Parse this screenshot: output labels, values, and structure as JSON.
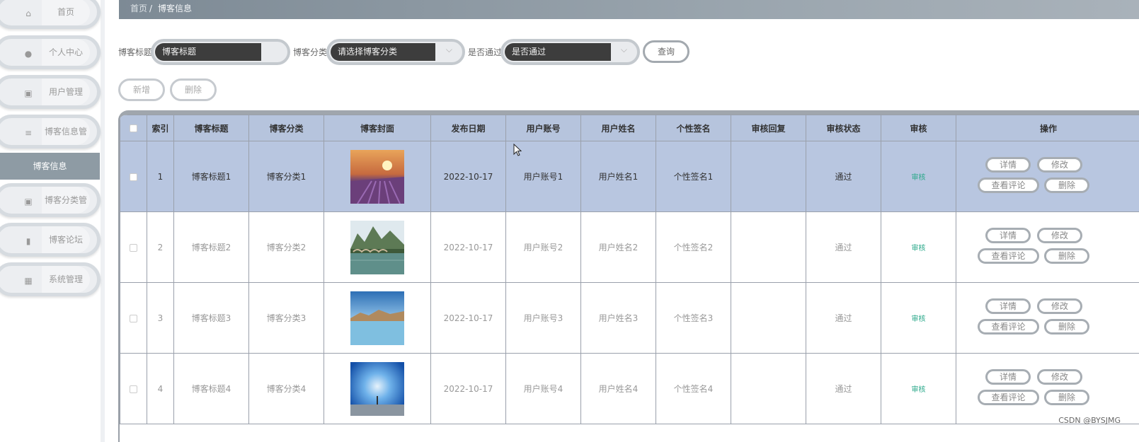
{
  "sidebar": {
    "items": [
      {
        "label": "首页",
        "icon": "home-icon",
        "glyph": "⌂"
      },
      {
        "label": "个人中心",
        "icon": "user-icon",
        "glyph": "●"
      },
      {
        "label": "用户管理",
        "icon": "clipboard-icon",
        "glyph": "▣"
      },
      {
        "label": "博客信息管理",
        "icon": "list-icon",
        "glyph": "≡"
      },
      {
        "label": "博客分类管理",
        "icon": "clipboard-check-icon",
        "glyph": "▣"
      },
      {
        "label": "博客论坛",
        "icon": "book-icon",
        "glyph": "▮"
      },
      {
        "label": "系统管理",
        "icon": "grid-icon",
        "glyph": "▦"
      }
    ],
    "active_sub": "博客信息"
  },
  "breadcrumb": {
    "home": "首页",
    "separator": "/",
    "current": "博客信息"
  },
  "search": {
    "title_label": "博客标题",
    "title_value": "博客标题",
    "category_label": "博客分类",
    "category_placeholder": "请选择博客分类",
    "pass_label": "是否通过",
    "pass_placeholder": "是否通过",
    "query_button": "查询"
  },
  "actions": {
    "add": "新增",
    "delete": "删除"
  },
  "table": {
    "headers": [
      "索引",
      "博客标题",
      "博客分类",
      "博客封面",
      "发布日期",
      "用户账号",
      "用户姓名",
      "个性签名",
      "审核回复",
      "审核状态",
      "审核",
      "操作"
    ],
    "rows": [
      {
        "index": "1",
        "title": "博客标题1",
        "category": "博客分类1",
        "date": "2022-10-17",
        "account": "用户账号1",
        "name": "用户姓名1",
        "signature": "个性签名1",
        "reply": "",
        "status": "通过",
        "audit": "审核"
      },
      {
        "index": "2",
        "title": "博客标题2",
        "category": "博客分类2",
        "date": "2022-10-17",
        "account": "用户账号2",
        "name": "用户姓名2",
        "signature": "个性签名2",
        "reply": "",
        "status": "通过",
        "audit": "审核"
      },
      {
        "index": "3",
        "title": "博客标题3",
        "category": "博客分类3",
        "date": "2022-10-17",
        "account": "用户账号3",
        "name": "用户姓名3",
        "signature": "个性签名3",
        "reply": "",
        "status": "通过",
        "audit": "审核"
      },
      {
        "index": "4",
        "title": "博客标题4",
        "category": "博客分类4",
        "date": "2022-10-17",
        "account": "用户账号4",
        "name": "用户姓名4",
        "signature": "个性签名4",
        "reply": "",
        "status": "通过",
        "audit": "审核"
      }
    ],
    "ops": {
      "detail": "详情",
      "edit": "修改",
      "comments": "查看评论",
      "delete": "删除"
    }
  },
  "watermark": "CSDN @BYSJMG",
  "colors": {
    "accent": "#8e9ba4",
    "highlight_row": "#b8c6e0",
    "header_bg": "#b6c4dd",
    "audit_link": "#2aa88a"
  }
}
